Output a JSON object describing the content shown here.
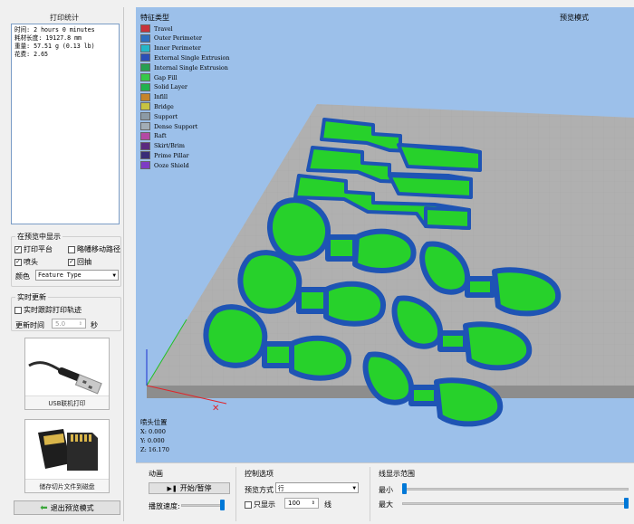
{
  "stats": {
    "title": "打印统计",
    "lines": [
      "时间: 2 hours 0 minutes",
      "耗材长度: 19127.8 mm",
      "重量: 57.51 g (0.13 lb)",
      "花费: 2.65"
    ]
  },
  "preview_display": {
    "title": "在预览中显示",
    "print_bed": {
      "label": "打印平台",
      "checked": true
    },
    "rapid_moves": {
      "label": "略幡移动路径",
      "checked": false
    },
    "nozzle": {
      "label": "喷头",
      "checked": true
    },
    "retract": {
      "label": "回抽",
      "checked": true
    },
    "color_label": "颜色",
    "color_value": "Feature Type"
  },
  "realtime": {
    "title": "实时更新",
    "track_label": "实时跟踪打印轨迹",
    "track_checked": false,
    "interval_label": "更新时间",
    "interval_value": "5.0",
    "interval_unit": "秒"
  },
  "usb_card": {
    "caption": "USB联机打印",
    "icon": "usb-cable-icon"
  },
  "sd_card": {
    "caption": "储存切片文件到磁盘",
    "icon": "sd-card-icon"
  },
  "exit_button": {
    "label": "退出预览模式",
    "icon": "arrow-back-icon"
  },
  "viewport": {
    "legend_title": "特征类型",
    "mode": "预览模式",
    "features": [
      {
        "name": "Travel",
        "color": "#c8323c"
      },
      {
        "name": "Outer Perimeter",
        "color": "#2f6fc0"
      },
      {
        "name": "Inner Perimeter",
        "color": "#24b7c8"
      },
      {
        "name": "External Single Extrusion",
        "color": "#2b4fb8"
      },
      {
        "name": "Internal Single Extrusion",
        "color": "#28a052"
      },
      {
        "name": "Gap Fill",
        "color": "#36c84a"
      },
      {
        "name": "Solid Layer",
        "color": "#21b24e"
      },
      {
        "name": "Infill",
        "color": "#c6842a"
      },
      {
        "name": "Bridge",
        "color": "#c7c341"
      },
      {
        "name": "Support",
        "color": "#8c9aa6"
      },
      {
        "name": "Dense Support",
        "color": "#a2adb6"
      },
      {
        "name": "Raft",
        "color": "#b34aa4"
      },
      {
        "name": "Skirt/Brim",
        "color": "#5b2a7e"
      },
      {
        "name": "Prime Pillar",
        "color": "#3a2d78"
      },
      {
        "name": "Ooze Shield",
        "color": "#7e3cc4"
      }
    ],
    "nozzle_title": "喷头位置",
    "nozzle_x": "X: 0.000",
    "nozzle_y": "Y: 0.000",
    "nozzle_z": "Z: 16.170"
  },
  "animation": {
    "title": "动画",
    "play_label": "开始/暂停",
    "speed_label": "播放速度:",
    "speed_level": 1.0
  },
  "control": {
    "title": "控制选项",
    "mode_label": "预览方式",
    "mode_value": "行",
    "only_show_label": "只显示",
    "only_show_checked": false,
    "count_value": "100",
    "count_unit": "线"
  },
  "line_range": {
    "title": "线显示范围",
    "min_label": "最小",
    "max_label": "最大",
    "min_level": 0.0,
    "max_level": 1.0
  }
}
